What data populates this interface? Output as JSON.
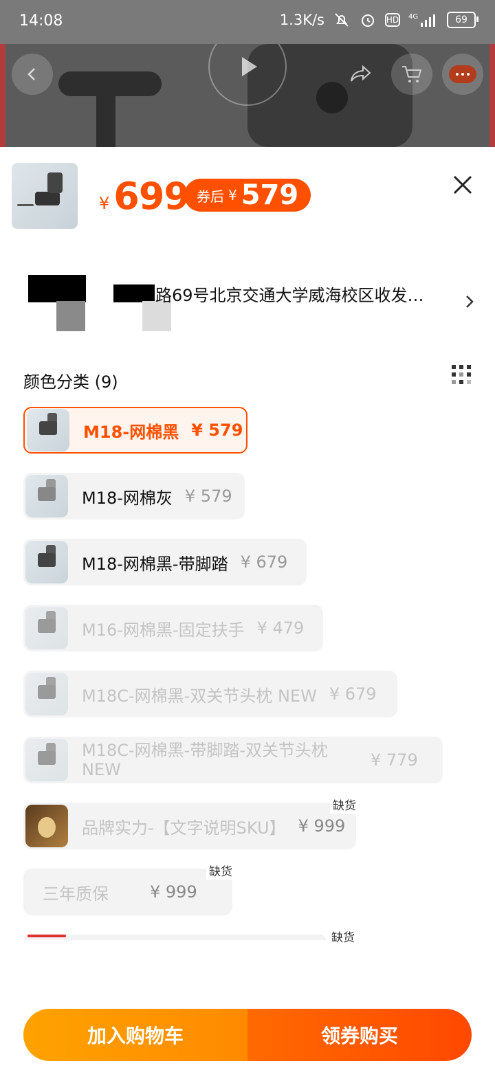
{
  "status_bar": {
    "time": "14:08",
    "net_speed": "1.3K/s",
    "network": "4G",
    "hd": "HD",
    "battery": "69"
  },
  "header": {
    "icons": [
      "back-icon",
      "play-icon",
      "share-icon",
      "cart-icon",
      "more-icon"
    ]
  },
  "sheet": {
    "price_currency": "¥",
    "price": "699",
    "coupon_label": "券后",
    "coupon_currency": "¥",
    "coupon_price": "579",
    "close_icon": "close-icon",
    "address": "路69号北京交通大学威海校区收发…",
    "section_title": "颜色分类 (9)",
    "accent_color": "#ff5000"
  },
  "skus": [
    {
      "name": "M18-网棉黑",
      "price": "¥ 579"
    },
    {
      "name": "M18-网棉灰",
      "price": "¥ 579"
    },
    {
      "name": "M18-网棉黑-带脚踏",
      "price": "¥ 679"
    },
    {
      "name": "M16-网棉黑-固定扶手",
      "price": "¥ 479"
    },
    {
      "name": "M18C-网棉黑-双关节头枕 NEW",
      "price": "¥ 679"
    },
    {
      "name": "M18C-网棉黑-带脚踏-双关节头枕 NEW",
      "price": "¥ 779"
    },
    {
      "name": "品牌实力-【文字说明SKU】",
      "price": "¥ 999",
      "tag": "缺货"
    },
    {
      "name": "三年质保",
      "price": "¥ 999",
      "tag": "缺货"
    },
    {
      "tag": "缺货"
    }
  ],
  "bottom": {
    "add_to_cart": "加入购物车",
    "buy_with_coupon": "领券购买"
  }
}
